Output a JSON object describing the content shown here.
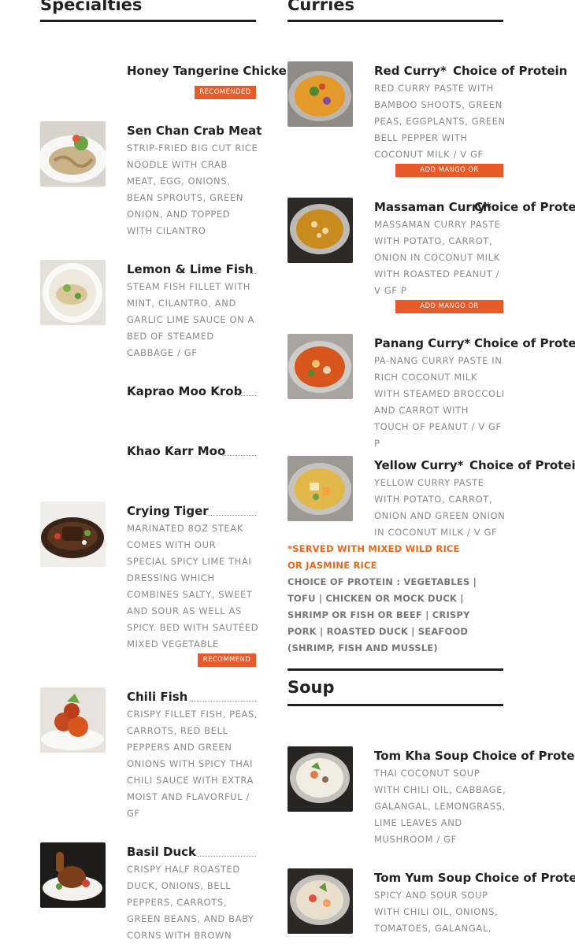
{
  "specialties": {
    "title": "Specialties",
    "items": [
      {
        "name": "Honey Tangerine Chicken",
        "badge": "RECOMENDED"
      },
      {
        "name": "Sen Chan Crab Meat",
        "image": "crab-noodle-plate",
        "description": "STRIP-FRIED BIG CUT RICE NOODLE WITH CRAB MEAT, EGG, ONIONS, BEAN SPROUTS, GREEN ONION, AND TOPPED WITH CILANTRO"
      },
      {
        "name": "Lemon & Lime Fish",
        "image": "fish-fillet-plate",
        "description": "STEAM FISH FILLET WITH MINT, CILANTRO, AND GARLIC LIME SAUCE ON A BED OF STEAMED CABBAGE / GF"
      },
      {
        "name": "Kaprao Moo Krob"
      },
      {
        "name": "Khao Karr Moo"
      },
      {
        "name": "Crying Tiger",
        "image": "steak-sizzling-plate",
        "description": "MARINATED 8OZ STEAK COMES WITH OUR SPECIAL SPICY LIME THAI DRESSING WHICH COMBINES SALTY, SWEET AND SOUR AS WELL AS SPICY. BED WITH SAUTÉED MIXED VEGETABLE",
        "badge": "RECOMMEND"
      },
      {
        "name": "Chili Fish",
        "image": "chili-fish-plate",
        "description": "CRISPY FILLET FISH, PEAS, CARROTS, RED BELL PEPPERS AND GREEN ONIONS WITH SPICY THAI CHILI SAUCE WITH EXTRA MOIST AND FLAVORFUL / GF"
      },
      {
        "name": "Basil Duck",
        "image": "roast-duck-plate",
        "description": "CRISPY HALF ROASTED DUCK, ONIONS, BELL PEPPERS, CARROTS, GREEN BEANS, AND BABY CORNS WITH BROWN"
      }
    ]
  },
  "curries": {
    "title": "Curries",
    "items": [
      {
        "name": "Red Curry*",
        "price": "Choice of Protein",
        "image": "red-curry-bowl",
        "description": "RED CURRY PASTE WITH BAMBOO SHOOTS, GREEN PEAS, EGGPLANTS, GREEN BELL PEPPER WITH COCONUT MILK / V GF",
        "badge": "ADD MANGO OR PINEAPPLE"
      },
      {
        "name": "Massaman Curry*",
        "price": "Choice of Protein",
        "image": "massaman-curry-bowl",
        "description": "MASSAMAN CURRY PASTE WITH POTATO, CARROT, ONION IN COCONUT MILK WITH ROASTED PEANUT / V GF P",
        "badge": "ADD MANGO OR PINEAPPLE"
      },
      {
        "name": "Panang Curry*",
        "price": "Choice of Protein",
        "image": "panang-curry-bowl",
        "description": "PA-NANG CURRY PASTE IN RICH COCONUT MILK WITH STEAMED BROCCOLI AND CARROT WITH TOUCH OF PEANUT / V GF P"
      },
      {
        "name": "Yellow Curry*",
        "price": "Choice of Protein",
        "image": "yellow-curry-bowl",
        "description": "YELLOW CURRY PASTE WITH POTATO, CARROT, ONION AND GREEN ONION IN COCONUT MILK / V GF"
      }
    ],
    "note_served": "*SERVED WITH MIXED WILD RICE OR JASMINE RICE",
    "note_protein": "CHOICE OF PROTEIN : VEGETABLES | TOFU | CHICKEN OR MOCK DUCK | SHRIMP OR FISH OR BEEF | CRISPY PORK | ROASTED DUCK | SEAFOOD (SHRIMP, FISH AND MUSSLE)"
  },
  "soup": {
    "title": "Soup",
    "items": [
      {
        "name": "Tom Kha Soup",
        "price": "Choice of Protein",
        "image": "tom-kha-bowl",
        "description": "THAI COCONUT SOUP WITH CHILI OIL, CABBAGE, GALANGAL, LEMONGRASS, LIME LEAVES AND MUSHROOM / GF"
      },
      {
        "name": "Tom Yum Soup",
        "price": "Choice of Protein",
        "image": "tom-yum-bowl",
        "description": "SPICY AND SOUR SOUP WITH CHILI OIL, ONIONS, TOMATOES, GALANGAL,"
      }
    ]
  },
  "colors": {
    "accent": "#e85a2a",
    "note_orange": "#e8691e",
    "rule": "#1f1f1f"
  }
}
